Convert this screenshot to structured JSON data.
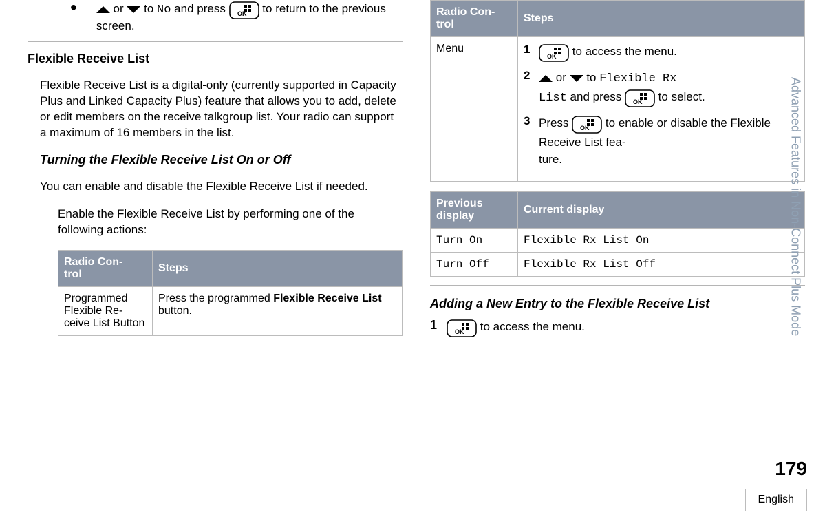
{
  "sideTab": "Advanced Features in Non-Connect Plus Mode",
  "pageNumber": "179",
  "language": "English",
  "topFrag": {
    "or": " or ",
    "to": " to ",
    "no": "No",
    "andPress": " and press ",
    "rest": " to return to the previous screen."
  },
  "h3_frl": "Flexible Receive List",
  "p_frl_desc": "Flexible Receive List is a digital-only (currently supported in Capacity Plus and Linked Capacity Plus) feature that allows you to add, delete or edit members on the receive talkgroup list. Your radio can support a maximum of 16 members in the list.",
  "h4_turn": "Turning the Flexible Receive List On or Off",
  "p_turn_desc": "You can enable and disable the Flexible Receive List if needed.",
  "p_enable": "Enable the Flexible Receive List by performing one of the following actions:",
  "table1": {
    "th1": "Radio Con-\ntrol",
    "th2": "Steps",
    "r1c1": "Programmed Flexible Re-\nceive List Button",
    "r1c2a": "Press the programmed ",
    "r1c2b": "Flexible Receive List",
    "r1c2c": " button."
  },
  "table2": {
    "th1": "Radio Con-\ntrol",
    "th2": "Steps",
    "r1c1": "Menu",
    "s1": " to access the menu.",
    "s2a": " or ",
    "s2b": " to ",
    "s2code1": "Flexible Rx",
    "s2code2": "List",
    "s2and": " and press ",
    "s2sel": " to select.",
    "s3a": "Press ",
    "s3b": " to enable or disable the Flexible Receive List fea-\nture."
  },
  "table3": {
    "th1": "Previous display",
    "th2": "Current display",
    "r1c1": "Turn On",
    "r1c2": "Flexible Rx List On",
    "r2c1": "Turn Off",
    "r2c2": "Flexible Rx List Off"
  },
  "h4_add": "Adding a New Entry to the Flexible Receive List",
  "add_s1": " to access the menu."
}
